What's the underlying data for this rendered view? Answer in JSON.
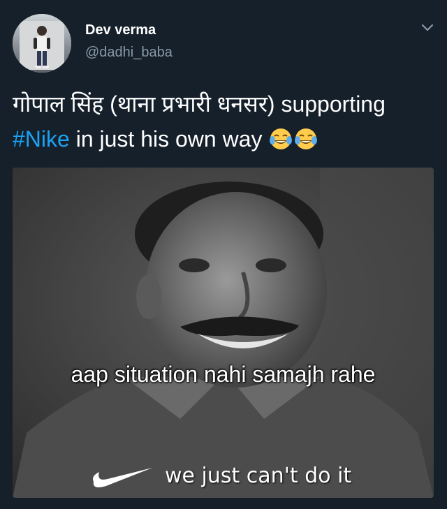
{
  "author": {
    "name": "Dev verma",
    "handle": "@dadhi_baba"
  },
  "tweet": {
    "text_before": "गोपाल सिंह (थाना प्रभारी धनसर) supporting ",
    "hashtag": "#Nike",
    "text_after": " in just his own way"
  },
  "media": {
    "caption": "aap situation nahi samajh rahe",
    "slogan": "we just can't do it"
  },
  "icons": {
    "menu": "chevron-down-icon",
    "emoji": "face-with-tears-of-joy-icon",
    "logo": "nike-swoosh-icon"
  },
  "colors": {
    "background": "#15202b",
    "hashtag": "#1da1f2",
    "secondary_text": "#8899a6"
  }
}
